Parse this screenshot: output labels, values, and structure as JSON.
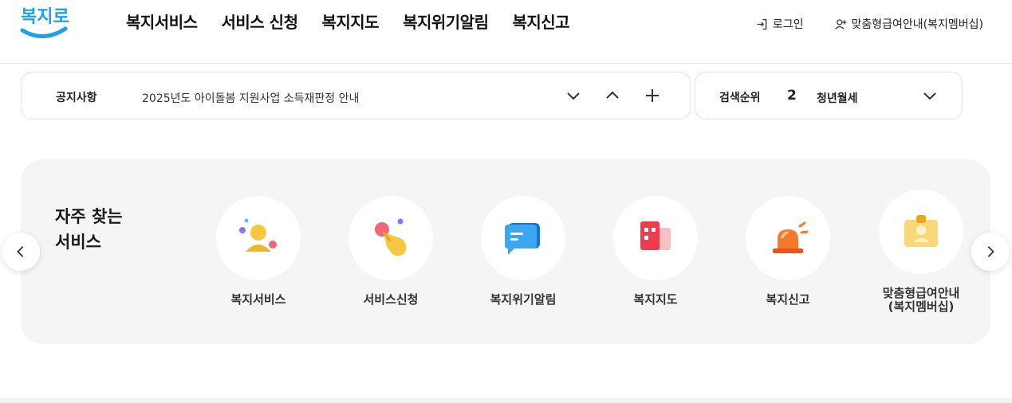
{
  "header": {
    "logo_text": "복지로",
    "nav": [
      "복지서비스",
      "서비스 신청",
      "복지지도",
      "복지위기알림",
      "복지신고"
    ],
    "login_label": "로그인",
    "membership_label": "맞춤형급여안내(복지멤버십)"
  },
  "notice": {
    "label": "공지사항",
    "text": "2025년도 아이돌봄 지원사업 소득재판정 안내"
  },
  "search_rank": {
    "label": "검색순위",
    "rank": "2",
    "term": "청년월세"
  },
  "frequent": {
    "title": "자주 찾는\n서비스",
    "items": [
      {
        "label": "복지서비스",
        "icon": "person-icon"
      },
      {
        "label": "서비스신청",
        "icon": "hand-pointer-icon"
      },
      {
        "label": "복지위기알림",
        "icon": "chat-bubble-icon"
      },
      {
        "label": "복지지도",
        "icon": "map-icon"
      },
      {
        "label": "복지신고",
        "icon": "siren-icon"
      },
      {
        "label": "맞춤형급여안내\n(복지멤버십)",
        "icon": "id-card-icon"
      }
    ]
  },
  "colors": {
    "brand_blue": "#1aa3e8",
    "panel_bg": "#f5f5f5"
  }
}
